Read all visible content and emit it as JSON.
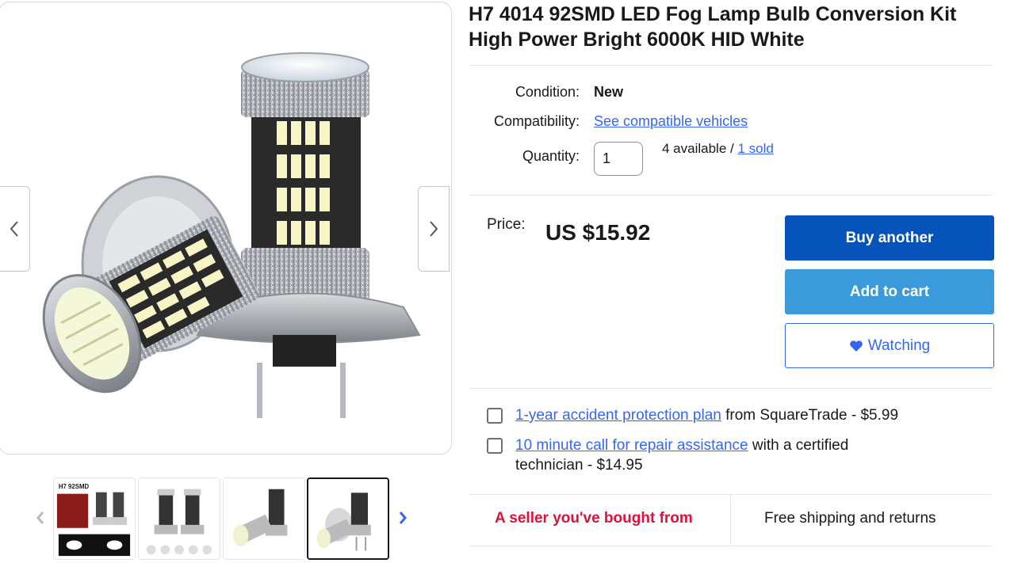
{
  "product": {
    "title_line1": "H7 4014 92SMD LED Fog Lamp Bulb Conversion Kit",
    "title_line2": "High Power Bright 6000K HID White"
  },
  "details": {
    "condition_label": "Condition:",
    "condition_value": "New",
    "compat_label": "Compatibility:",
    "compat_link": "See compatible vehicles",
    "quantity_label": "Quantity:",
    "quantity_value": "1",
    "available_text": "4 available / ",
    "sold_link": "1 sold"
  },
  "pricing": {
    "price_label": "Price:",
    "price": "US $15.92"
  },
  "actions": {
    "buy_label": "Buy another",
    "cart_label": "Add to cart",
    "watch_label": "Watching"
  },
  "addons": [
    {
      "link": "1-year accident protection plan",
      "text": " from SquareTrade - $5.99"
    },
    {
      "link": "10 minute call for repair assistance",
      "text": " with a certified technician - $14.95"
    }
  ],
  "badges": {
    "seller": "A seller you've bought from",
    "shipping": "Free shipping and returns"
  },
  "gallery": {
    "thumb1_caption": "H7 92SMD",
    "thumb_count": 4,
    "selected_index": 3
  },
  "colors": {
    "buy": "#0654ba",
    "cart": "#3b9ad9",
    "link": "#3665f3",
    "seller": "#e0103a"
  },
  "icons": {
    "prev": "chevron-left-icon",
    "next": "chevron-right-icon",
    "watch": "heart-icon"
  }
}
